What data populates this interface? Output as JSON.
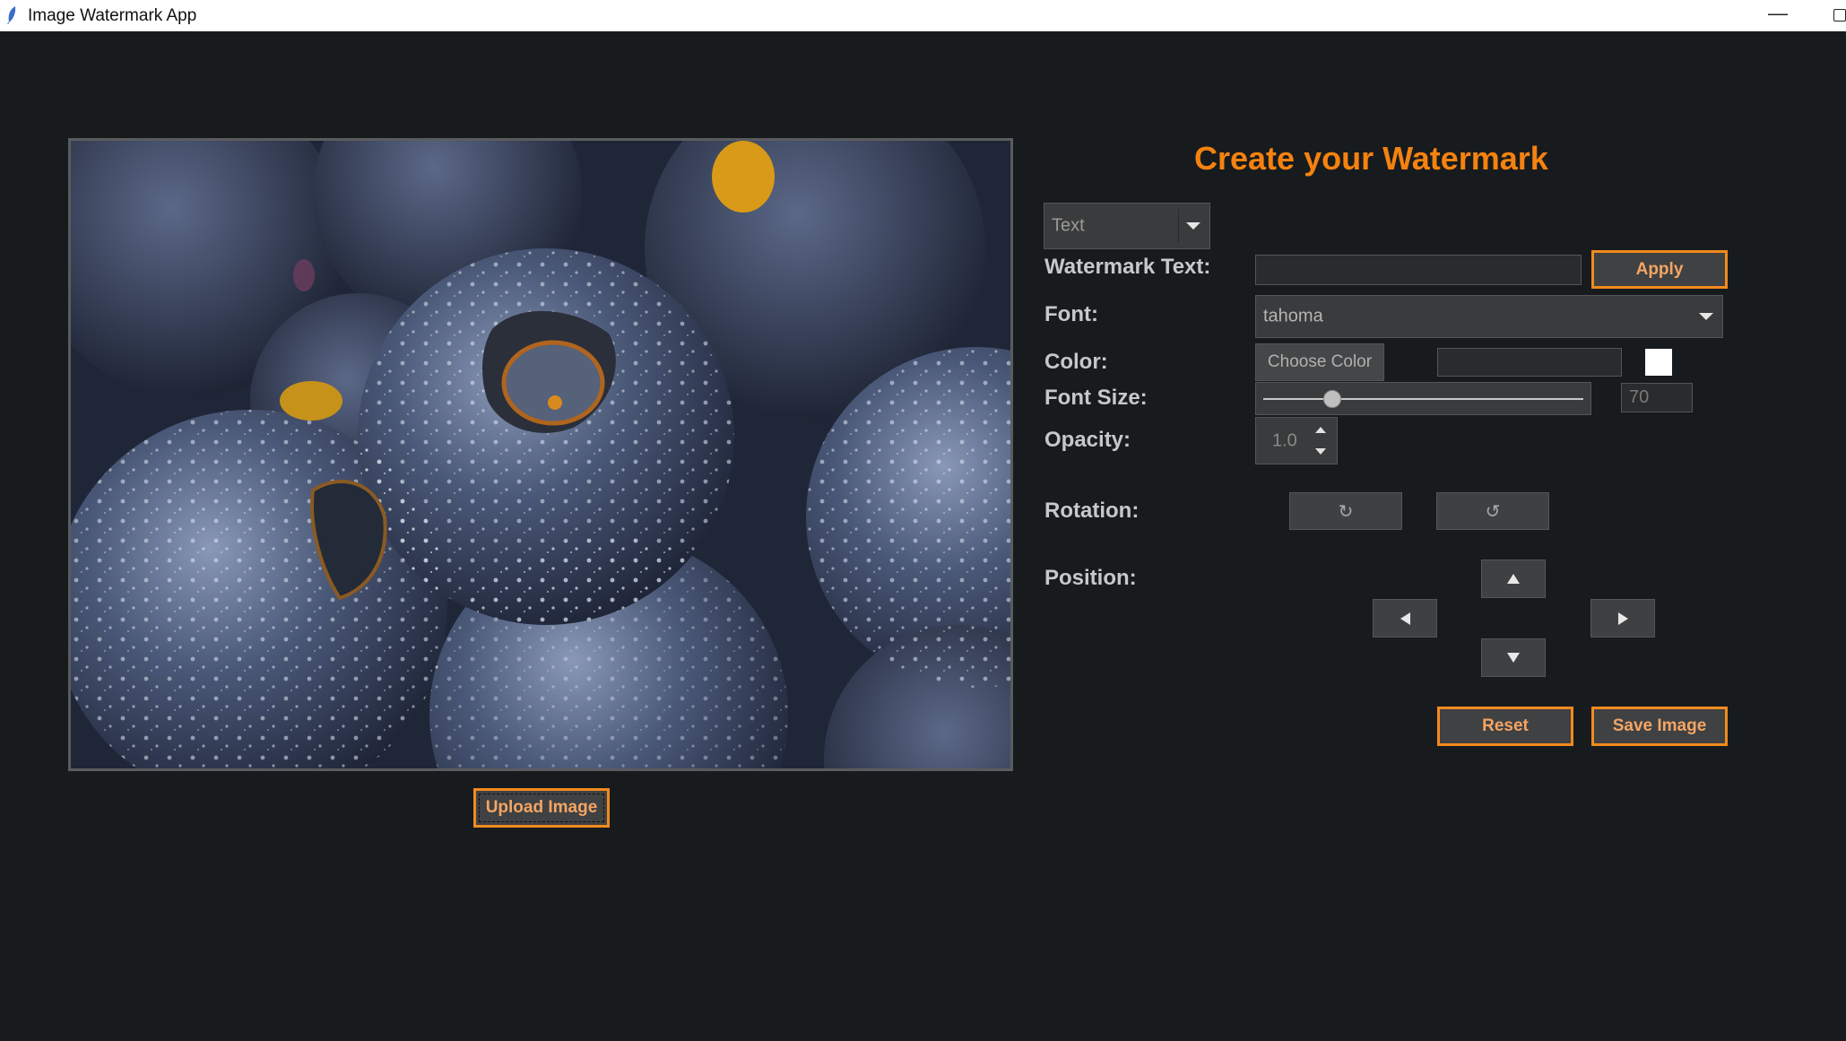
{
  "window": {
    "title": "Image Watermark App",
    "minimize_glyph": "—"
  },
  "image": {
    "description_icon": "photo-preview"
  },
  "upload": {
    "label": "Upload Image"
  },
  "panel": {
    "heading": "Create your Watermark",
    "watermark_type": "Text",
    "labels": {
      "watermark_text": "Watermark Text:",
      "font": "Font:",
      "color": "Color:",
      "font_size": "Font Size:",
      "opacity": "Opacity:",
      "rotation": "Rotation:",
      "position": "Position:"
    },
    "watermark_text_value": "",
    "apply_label": "Apply",
    "font_value": "tahoma",
    "choose_color_label": "Choose Color",
    "color_hex_value": "",
    "color_swatch": "#ffffff",
    "font_size": {
      "value": "70",
      "min": 0,
      "max": 350,
      "level": 0.2
    },
    "opacity_value": "1.0",
    "rotate_left_glyph": "↻",
    "rotate_right_glyph": "↺",
    "reset_label": "Reset",
    "save_label": "Save Image"
  },
  "colors": {
    "background": "#171b1e",
    "accent": "#f5820f",
    "button_text": "#f4a564",
    "label": "#c8c8c8"
  }
}
